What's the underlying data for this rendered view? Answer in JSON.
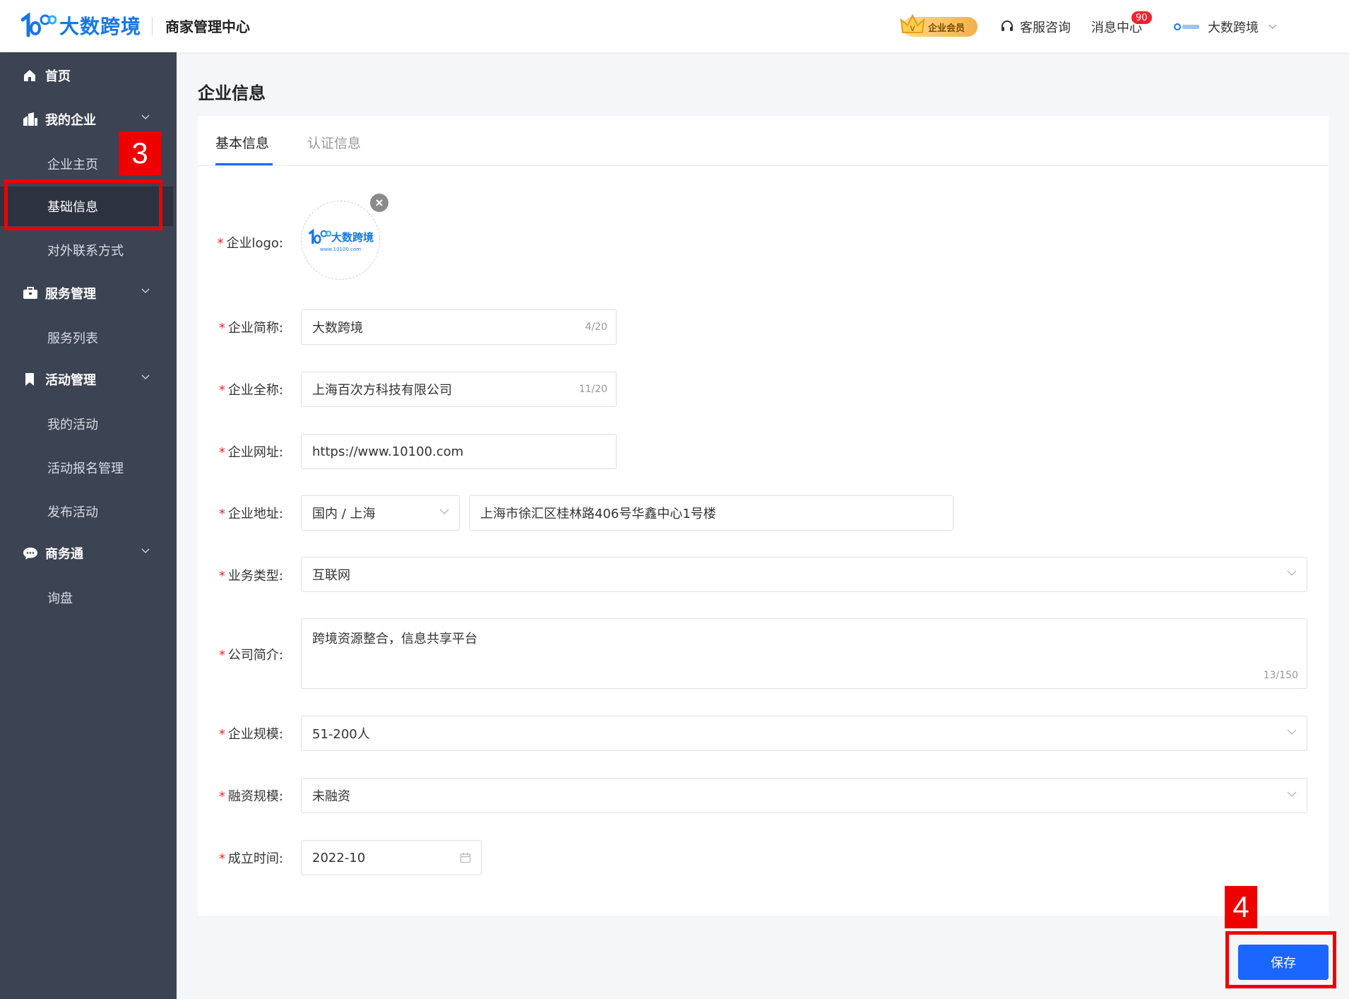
{
  "header": {
    "brand": "大数跨境",
    "app_title": "商家管理中心",
    "vip_label": "企业会员",
    "service_label": "客服咨询",
    "messages_label": "消息中心",
    "messages_count": "90",
    "user_name": "大数跨境"
  },
  "sidebar": {
    "home": "首页",
    "groups": [
      {
        "label": "我的企业",
        "items": [
          "企业主页",
          "基础信息",
          "对外联系方式"
        ]
      },
      {
        "label": "服务管理",
        "items": [
          "服务列表"
        ]
      },
      {
        "label": "活动管理",
        "items": [
          "我的活动",
          "活动报名管理",
          "发布活动"
        ]
      },
      {
        "label": "商务通",
        "items": [
          "询盘"
        ]
      }
    ],
    "active_item": "基础信息"
  },
  "page": {
    "title": "企业信息",
    "tabs": [
      "基本信息",
      "认证信息"
    ],
    "active_tab": "基本信息"
  },
  "form": {
    "logo_label": "企业logo:",
    "logo_image_brand": "大数跨境",
    "logo_image_url": "www.10100.com",
    "short_name_label": "企业简称:",
    "short_name_value": "大数跨境",
    "short_name_counter": "4/20",
    "full_name_label": "企业全称:",
    "full_name_value": "上海百次方科技有限公司",
    "full_name_counter": "11/20",
    "website_label": "企业网址:",
    "website_value": "https://www.10100.com",
    "address_label": "企业地址:",
    "address_region": "国内 / 上海",
    "address_detail": "上海市徐汇区桂林路406号华鑫中心1号楼",
    "business_type_label": "业务类型:",
    "business_type_value": "互联网",
    "intro_label": "公司简介:",
    "intro_value": "跨境资源整合，信息共享平台",
    "intro_counter": "13/150",
    "scale_label": "企业规模:",
    "scale_value": "51-200人",
    "funding_label": "融资规模:",
    "funding_value": "未融资",
    "founded_label": "成立时间:",
    "founded_value": "2022-10"
  },
  "actions": {
    "save_label": "保存"
  },
  "annotations": {
    "step_a": "3",
    "step_b": "4"
  },
  "colors": {
    "primary": "#1a66ff",
    "sidebar_bg": "#3c4353",
    "annotation": "#ef0000",
    "badge": "#f5222d"
  }
}
